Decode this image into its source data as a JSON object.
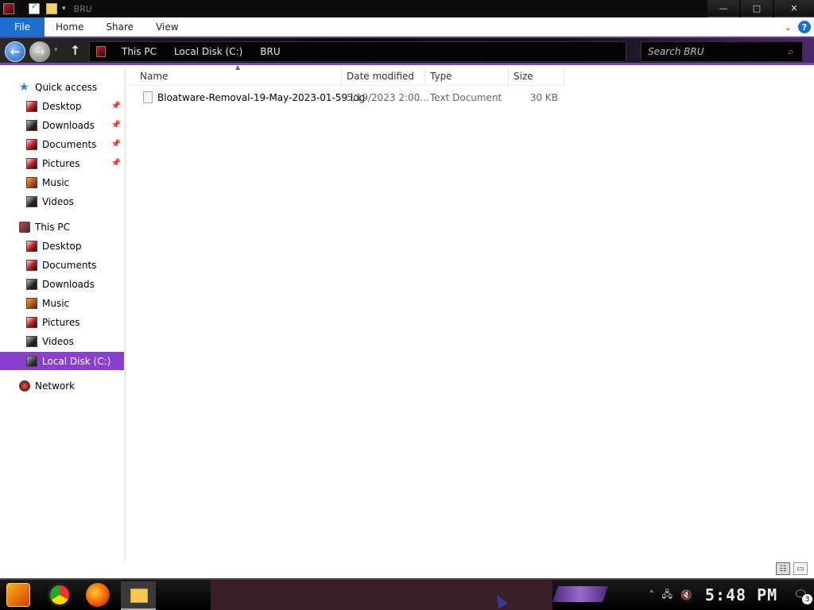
{
  "window": {
    "title": "BRU",
    "quick_access_dropdown": "▾",
    "controls": {
      "minimize": "—",
      "maximize": "□",
      "close": "✕"
    }
  },
  "ribbon": {
    "tabs": [
      "File",
      "Home",
      "Share",
      "View"
    ],
    "expand_glyph": "⌄",
    "help_glyph": "?"
  },
  "address": {
    "back_glyph": "←",
    "forward_glyph": "→",
    "recent_glyph": "▾",
    "up_glyph": "↑",
    "breadcrumbs": [
      "This PC",
      "Local Disk (C:)",
      "BRU"
    ],
    "search_placeholder": "Search BRU",
    "search_icon": "⌕"
  },
  "navigation": {
    "pin_icon": "📌",
    "quick_access": "Quick access",
    "quick_items": [
      {
        "label": "Desktop",
        "icon": "desktop-icon",
        "pinned": true
      },
      {
        "label": "Downloads",
        "icon": "downloads-icon",
        "pinned": true
      },
      {
        "label": "Documents",
        "icon": "documents-icon",
        "pinned": true
      },
      {
        "label": "Pictures",
        "icon": "pictures-icon",
        "pinned": true
      },
      {
        "label": "Music",
        "icon": "music-icon",
        "pinned": false
      },
      {
        "label": "Videos",
        "icon": "videos-icon",
        "pinned": false
      }
    ],
    "this_pc": "This PC",
    "pc_items": [
      {
        "label": "Desktop",
        "icon": "desktop-icon"
      },
      {
        "label": "Documents",
        "icon": "documents-icon"
      },
      {
        "label": "Downloads",
        "icon": "downloads-icon"
      },
      {
        "label": "Music",
        "icon": "music-icon"
      },
      {
        "label": "Pictures",
        "icon": "pictures-icon"
      },
      {
        "label": "Videos",
        "icon": "videos-icon"
      },
      {
        "label": "Local Disk (C:)",
        "icon": "drive-icon",
        "selected": true
      }
    ],
    "network": "Network"
  },
  "files": {
    "columns": [
      "Name",
      "Date modified",
      "Type",
      "Size"
    ],
    "sort_glyph": "▲",
    "rows": [
      {
        "name": "Bloatware-Removal-19-May-2023-01-59.log",
        "date": "5/19/2023 2:00...",
        "type": "Text Document",
        "size": "30 KB"
      }
    ]
  },
  "view_buttons": {
    "details": "☷",
    "large_icons": "▭"
  },
  "taskbar": {
    "apps": [
      "start-icon",
      "chrome-icon",
      "firefox-icon",
      "file-explorer-icon"
    ],
    "tray": {
      "overflow": "˄",
      "network": "🖧",
      "volume": "🔇",
      "time": "5:48 PM",
      "action_center": "🗨",
      "notification_count": "3"
    }
  },
  "colors": {
    "accent": "#8a3fd0",
    "file_tab": "#1a6fd0",
    "titlebar": "#0c0c0c"
  }
}
